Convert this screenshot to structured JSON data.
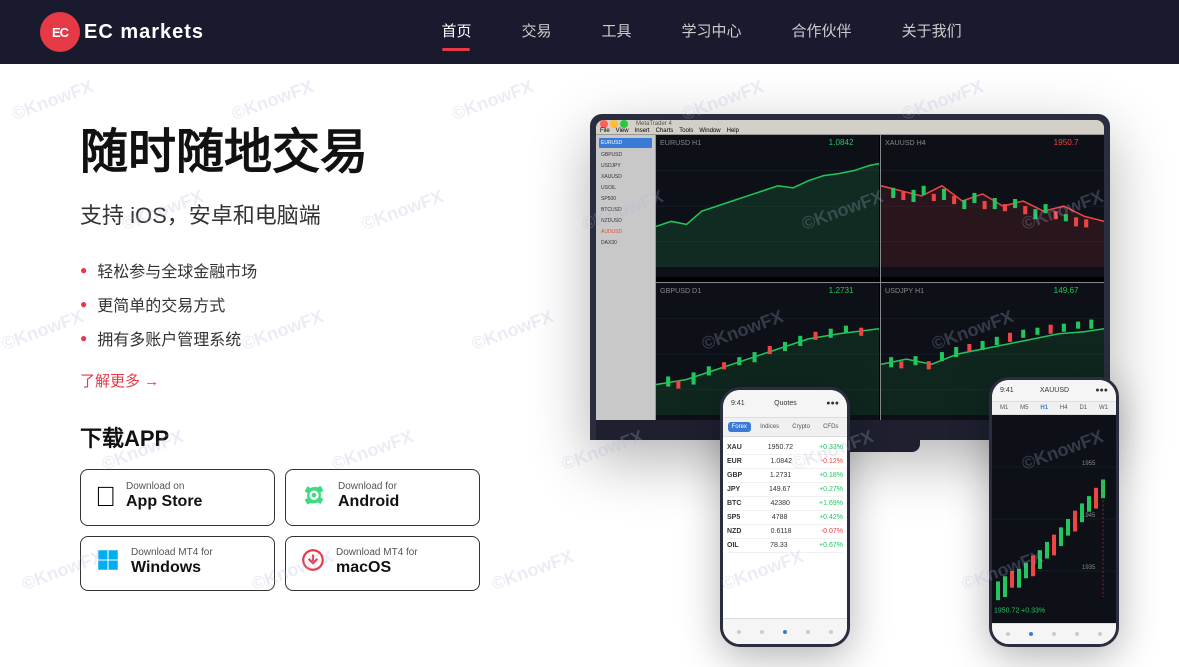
{
  "site": {
    "name": "EC markets",
    "logo_letters": "EC"
  },
  "nav": {
    "items": [
      {
        "id": "home",
        "label": "首页",
        "active": true
      },
      {
        "id": "trade",
        "label": "交易",
        "active": false
      },
      {
        "id": "tools",
        "label": "工具",
        "active": false
      },
      {
        "id": "learn",
        "label": "学习中心",
        "active": false
      },
      {
        "id": "partner",
        "label": "合作伙伴",
        "active": false
      },
      {
        "id": "about",
        "label": "关于我们",
        "active": false
      }
    ]
  },
  "hero": {
    "title": "随时随地交易",
    "subtitle": "支持 iOS，安卓和电脑端",
    "features": [
      "轻松参与全球金融市场",
      "更简单的交易方式",
      "拥有多账户管理系统"
    ],
    "learn_more_label": "了解更多 →"
  },
  "download": {
    "section_title": "下载APP",
    "buttons": [
      {
        "id": "appstore",
        "small_label": "Download on",
        "large_label": "App Store",
        "icon": "apple"
      },
      {
        "id": "android",
        "small_label": "Download for",
        "large_label": "Android",
        "icon": "android"
      },
      {
        "id": "windows",
        "small_label": "Download MT4 for",
        "large_label": "Windows",
        "icon": "windows"
      },
      {
        "id": "macos",
        "small_label": "Download MT4 for",
        "large_label": "macOS",
        "icon": "macos"
      }
    ]
  },
  "watermark": {
    "text": "©KnowFX"
  },
  "quotes": [
    {
      "name": "XAUUSD",
      "price": "1950.72",
      "change": "+0.33%",
      "up": true
    },
    {
      "name": "EURUSD",
      "price": "1.0842",
      "change": "-0.12%",
      "up": false
    },
    {
      "name": "GBPUSD",
      "price": "1.2731",
      "change": "+0.18%",
      "up": true
    },
    {
      "name": "USDJPY",
      "price": "149.67",
      "change": "+0.27%",
      "up": true
    },
    {
      "name": "BTCUSD",
      "price": "42380",
      "change": "+1.69%",
      "up": true
    },
    {
      "name": "SP500",
      "price": "4788",
      "change": "+0.42%",
      "up": true
    },
    {
      "name": "NZDUSD",
      "price": "0.6118",
      "change": "-0.07%",
      "up": false
    },
    {
      "name": "USOIL",
      "price": "78.33",
      "change": "+0.67%",
      "up": true
    }
  ]
}
